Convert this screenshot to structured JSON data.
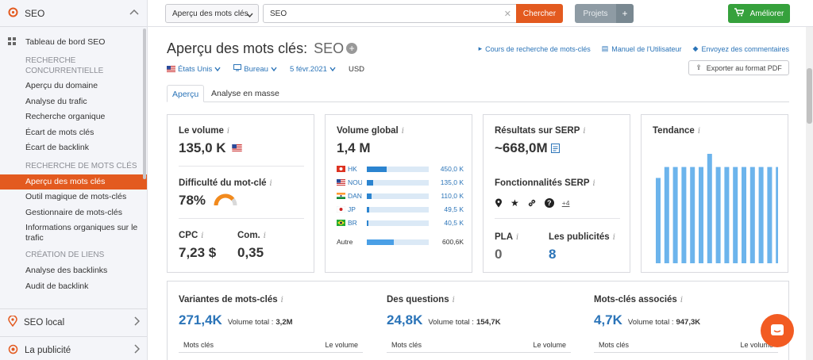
{
  "sidebar": {
    "top_label": "SEO",
    "dashboard": "Tableau de bord SEO",
    "section1": "RECHERCHE CONCURRENTIELLE",
    "comp_items": [
      "Aperçu du domaine",
      "Analyse du trafic",
      "Recherche organique",
      "Écart de mots clés",
      "Écart de backlink"
    ],
    "section2": "RECHERCHE DE MOTS CLÉS",
    "kw_items": [
      "Aperçu des mots clés",
      "Outil magique de mots-clés",
      "Gestionnaire de mots-clés",
      "Informations organiques sur le trafic"
    ],
    "section3": "CRÉATION DE LIENS",
    "link_items": [
      "Analyse des backlinks",
      "Audit de backlink"
    ],
    "bottom1": "SEO local",
    "bottom2": "La publicité"
  },
  "topbar": {
    "db_select": "Aperçu des mots clés",
    "search_value": "SEO",
    "search_btn": "Chercher",
    "projects": "Projets",
    "upgrade": "Améliorer"
  },
  "header": {
    "title": "Aperçu des mots clés:",
    "keyword": "SEO",
    "link1": "Cours de recherche de mots-clés",
    "link2": "Manuel de l'Utilisateur",
    "link3": "Envoyez des commentaires",
    "export": "Exporter au format PDF",
    "country": "États Unis",
    "device": "Bureau",
    "date": "5 févr.2021",
    "currency": "USD"
  },
  "tabs": [
    "Aperçu",
    "Analyse en masse"
  ],
  "cards": {
    "volume_label": "Le volume",
    "volume_value": "135,0 K",
    "kd_label": "Difficulté du mot-clé",
    "kd_value": "78%",
    "kd_percent": 78,
    "cpc_label": "CPC",
    "cpc_value": "7,23 $",
    "com_label": "Com.",
    "com_value": "0,35",
    "global_label": "Volume global",
    "global_value": "1,4 M",
    "countries": [
      {
        "code": "HK",
        "value": "450,0 K",
        "share": 0.32
      },
      {
        "code": "NOUS",
        "value": "135,0 K",
        "share": 0.1
      },
      {
        "code": "DANS",
        "value": "110,0 K",
        "share": 0.08
      },
      {
        "code": "JP",
        "value": "49,5 K",
        "share": 0.04
      },
      {
        "code": "BR",
        "value": "40,5 K",
        "share": 0.03
      }
    ],
    "other_label": "Autre",
    "other_value": "600,6K",
    "other_share": 0.44,
    "serp_label": "Résultats sur SERP",
    "serp_value": "~668,0M",
    "serp_feat_label": "Fonctionnalités SERP",
    "serp_more": "+4",
    "pla_label": "PLA",
    "pla_value": "0",
    "ads_label": "Les publicités",
    "ads_value": "8",
    "trend_label": "Tendance",
    "var_label": "Variantes de mots-clés",
    "var_value": "271,4K",
    "var_total_label": "Volume total :",
    "var_total": "3,2M",
    "q_label": "Des questions",
    "q_value": "24,8K",
    "q_total_label": "Volume total :",
    "q_total": "154,7K",
    "rel_label": "Mots-clés associés",
    "rel_value": "4,7K",
    "rel_total_label": "Volume total :",
    "rel_total": "947,3K",
    "col_kw": "Mots clés",
    "col_vol": "Le volume"
  },
  "chart_data": {
    "type": "bar",
    "title": "Tendance",
    "values": [
      0.78,
      0.88,
      0.88,
      0.88,
      0.88,
      0.88,
      1.0,
      0.88,
      0.88,
      0.88,
      0.88,
      0.88,
      0.88,
      0.88,
      0.88
    ],
    "ylim": [
      0,
      1
    ]
  },
  "colors": {
    "accent": "#e35a1f",
    "link": "#2b74b8",
    "bar": "#6cb4ec",
    "green": "#36a13c"
  }
}
